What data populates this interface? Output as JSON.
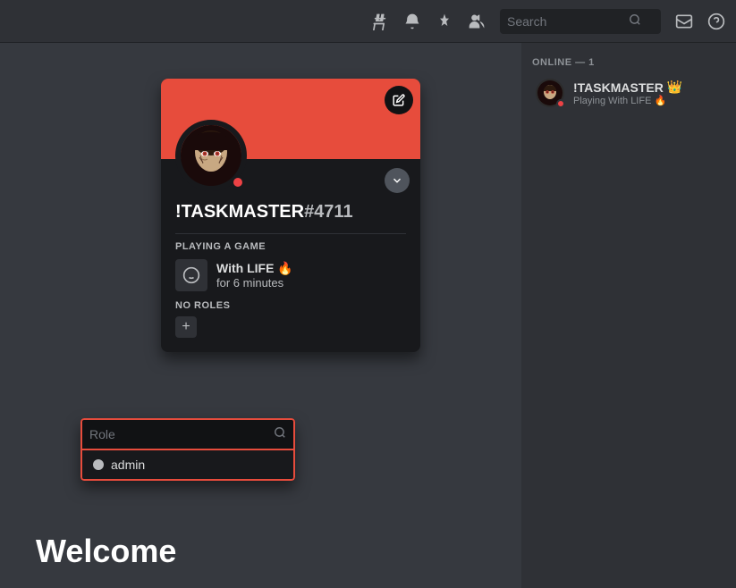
{
  "topbar": {
    "search_placeholder": "Search"
  },
  "profile": {
    "username": "!TASKMASTER",
    "discriminator": "#4711",
    "banner_color": "#e74c3c",
    "playing_label": "PLAYING A GAME",
    "game_name": "With LIFE 🔥",
    "game_duration": "for 6 minutes",
    "no_roles_label": "NO ROLES",
    "edit_icon": "✏",
    "dropdown_icon": "▾",
    "add_role_icon": "+"
  },
  "role_dropdown": {
    "search_placeholder": "Role",
    "items": [
      {
        "name": "admin",
        "color": "#b9bbbe"
      }
    ]
  },
  "sidebar": {
    "online_header": "ONLINE — 1",
    "members": [
      {
        "name": "!TASKMASTER",
        "crown": "👑",
        "activity": "Playing With LIFE 🔥",
        "status": "dnd"
      }
    ]
  },
  "welcome": {
    "text": "Welcome"
  },
  "icons": {
    "hashtag": "＃",
    "bell": "🔔",
    "pin": "📌",
    "person": "👤",
    "search": "🔍",
    "inbox": "📥",
    "help": "❓",
    "question_mark": "?"
  }
}
